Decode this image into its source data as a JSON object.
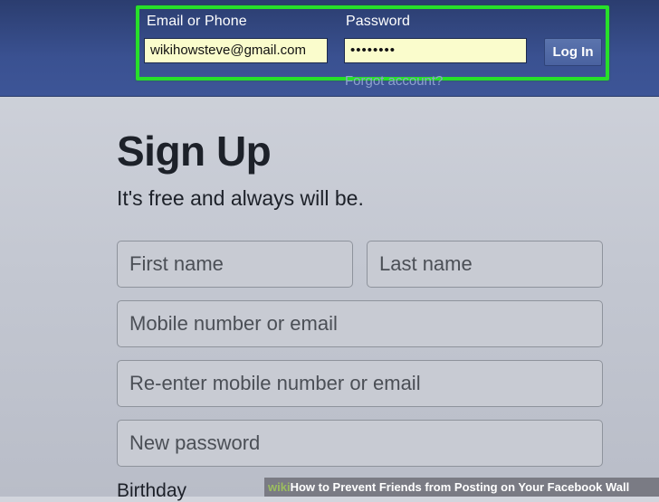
{
  "login": {
    "email_label": "Email or Phone",
    "email_value": "wikihowsteve@gmail.com",
    "password_label": "Password",
    "password_value": "••••••••",
    "login_button": "Log In",
    "forgot_link": "Forgot account?"
  },
  "signup": {
    "title": "Sign Up",
    "subtitle": "It's free and always will be.",
    "first_name_placeholder": "First name",
    "last_name_placeholder": "Last name",
    "mobile_placeholder": "Mobile number or email",
    "reenter_placeholder": "Re-enter mobile number or email",
    "password_placeholder": "New password",
    "birthday_label": "Birthday"
  },
  "caption": {
    "wiki": "wiki",
    "how": "How",
    "text": " to Prevent Friends from Posting on Your Facebook Wall"
  },
  "colors": {
    "highlight": "#27e02a",
    "topbar": "#3b5998",
    "input_fill": "#fafccc"
  }
}
